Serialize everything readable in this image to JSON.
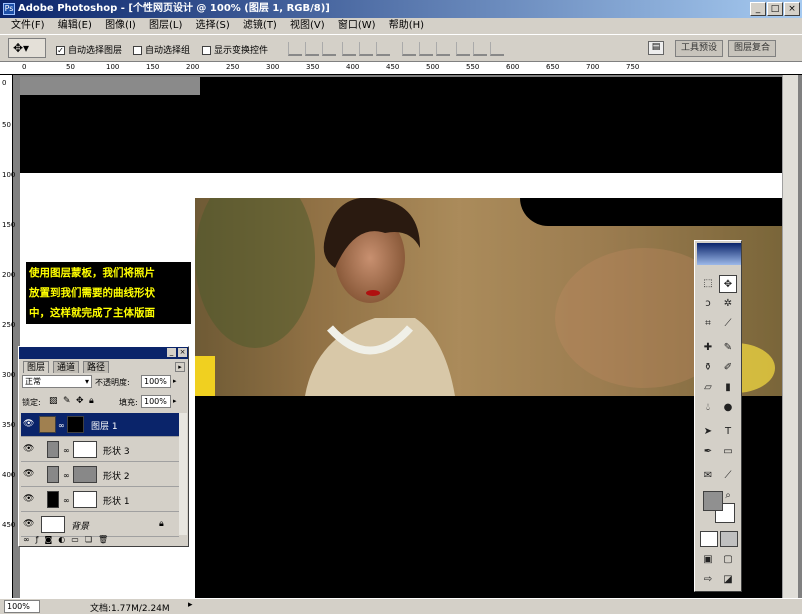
{
  "window": {
    "title": "Adobe Photoshop - [个性网页设计 @ 100% (图层 1, RGB/8)]",
    "min": "_",
    "max": "□",
    "close": "×"
  },
  "menu": [
    "文件(F)",
    "编辑(E)",
    "图像(I)",
    "图层(L)",
    "选择(S)",
    "滤镜(T)",
    "视图(V)",
    "窗口(W)",
    "帮助(H)"
  ],
  "options": {
    "auto_select_layer": "自动选择图层",
    "auto_select_group": "自动选择组",
    "show_transform": "显示变换控件",
    "tool_presets_tab": "工具预设",
    "layer_comps_tab": "图层复合"
  },
  "ruler": {
    "h": [
      "0",
      "50",
      "100",
      "150",
      "200",
      "250",
      "300",
      "350",
      "400",
      "450",
      "500",
      "550",
      "600",
      "650",
      "700",
      "750"
    ],
    "v": [
      "0",
      "50",
      "100",
      "150",
      "200",
      "250",
      "300",
      "350",
      "400",
      "450"
    ]
  },
  "canvas_text": [
    "使用图层蒙板，我们将照片",
    "放置到我们需要的曲线形状",
    "中，这样就完成了主体版面"
  ],
  "layers_panel": {
    "tabs": [
      "图层",
      "通道",
      "路径"
    ],
    "blend_mode": "正常",
    "opacity_label": "不透明度:",
    "opacity": "100%",
    "lock_label": "锁定:",
    "fill_label": "填充:",
    "fill": "100%",
    "layers": [
      {
        "name": "图层 1",
        "selected": true
      },
      {
        "name": "形状 3",
        "selected": false
      },
      {
        "name": "形状 2",
        "selected": false
      },
      {
        "name": "形状 1",
        "selected": false
      },
      {
        "name": "背景",
        "selected": false
      }
    ]
  },
  "status": {
    "zoom": "100%",
    "doc": "文档:1.77M/2.24M"
  },
  "colors": {
    "title_bar": "#0a246a",
    "canvas_text": "#ffff00",
    "bg": "#d4d0c8"
  }
}
